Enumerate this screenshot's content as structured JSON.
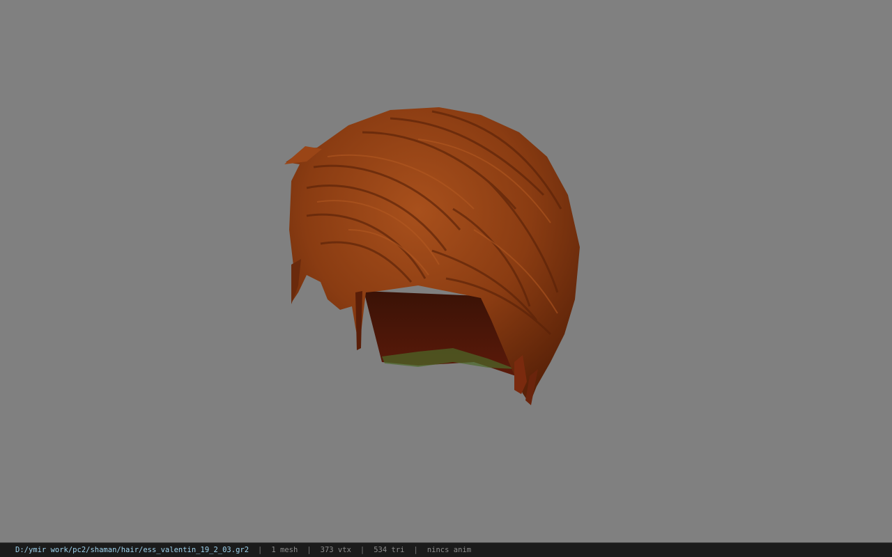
{
  "viewport": {
    "background_color": "#808080",
    "model_name": "hair-model",
    "hair_color": "#8a3c12"
  },
  "status_bar": {
    "file_path": "D:/ymir work/pc2/shaman/hair/ess_valentin_19_2_03.gr2",
    "separator": "|",
    "mesh_count": "1 mesh",
    "vertex_count": "373 vtx",
    "triangle_count": "534 tri",
    "anim_status": "nincs anim"
  }
}
